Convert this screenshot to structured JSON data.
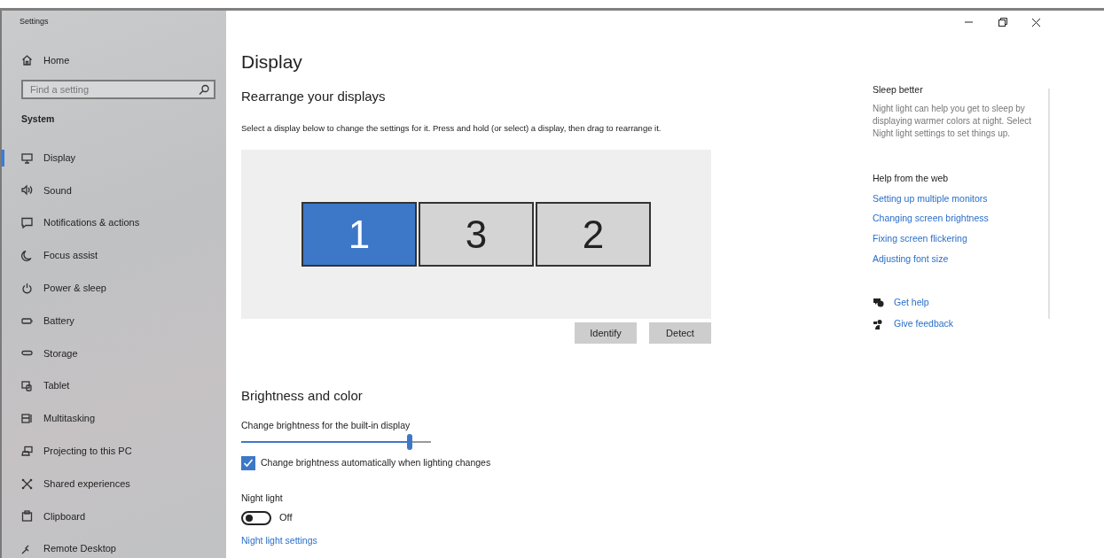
{
  "window": {
    "title": "Settings"
  },
  "sidebar": {
    "home": "Home",
    "search": {
      "placeholder": "Find a setting"
    },
    "section": "System",
    "items": [
      {
        "label": "Display",
        "selected": true
      },
      {
        "label": "Sound",
        "selected": false
      },
      {
        "label": "Notifications & actions",
        "selected": false
      },
      {
        "label": "Focus assist",
        "selected": false
      },
      {
        "label": "Power & sleep",
        "selected": false
      },
      {
        "label": "Battery",
        "selected": false
      },
      {
        "label": "Storage",
        "selected": false
      },
      {
        "label": "Tablet",
        "selected": false
      },
      {
        "label": "Multitasking",
        "selected": false
      },
      {
        "label": "Projecting to this PC",
        "selected": false
      },
      {
        "label": "Shared experiences",
        "selected": false
      },
      {
        "label": "Clipboard",
        "selected": false
      },
      {
        "label": "Remote Desktop",
        "selected": false
      }
    ]
  },
  "page": {
    "title": "Display",
    "rearrange": {
      "heading": "Rearrange your displays",
      "description": "Select a display below to change the settings for it. Press and hold (or select) a display, then drag to rearrange it.",
      "monitors": [
        {
          "label": "1",
          "selected": true
        },
        {
          "label": "3",
          "selected": false
        },
        {
          "label": "2",
          "selected": false
        }
      ],
      "buttons": [
        "Identify",
        "Detect"
      ]
    },
    "brightness": {
      "heading": "Brightness and color",
      "slider_label": "Change brightness for the built-in display",
      "level": 0.89,
      "auto": {
        "label": "Change brightness automatically when lighting changes",
        "checked": true
      },
      "night_light": {
        "label": "Night light",
        "on": false,
        "state_text": "Off"
      },
      "settings_link": "Night light settings"
    }
  },
  "aside": {
    "sleep": {
      "heading": "Sleep better",
      "text": "Night light can help you get to sleep by displaying warmer colors at night. Select Night light settings to set things up."
    },
    "help": {
      "heading": "Help from the web",
      "links": [
        "Setting up multiple monitors",
        "Changing screen brightness",
        "Fixing screen flickering",
        "Adjusting font size"
      ]
    },
    "actions": [
      "Get help",
      "Give feedback"
    ]
  }
}
